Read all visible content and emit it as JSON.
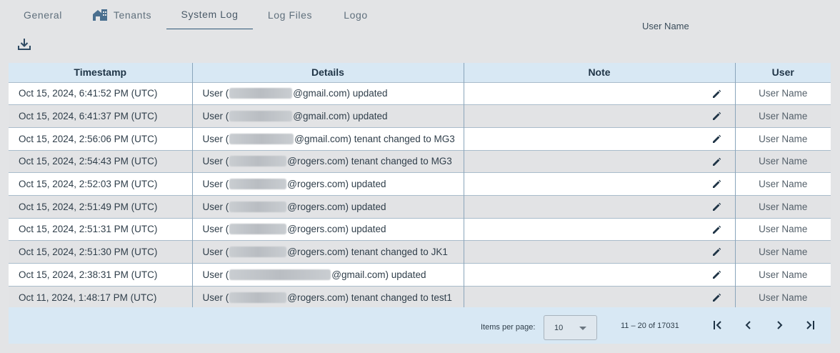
{
  "tabs": [
    {
      "label": "General"
    },
    {
      "label": "Tenants",
      "icon": "home-icon"
    },
    {
      "label": "System Log",
      "active": true
    },
    {
      "label": "Log Files"
    },
    {
      "label": "Logo"
    }
  ],
  "header": {
    "user_name": "User Name"
  },
  "toolbar": {
    "download_icon": "download-icon"
  },
  "table": {
    "columns": [
      "Timestamp",
      "Details",
      "Note",
      "User"
    ],
    "rows": [
      {
        "timestamp": "Oct 15, 2024, 6:41:52 PM (UTC)",
        "detail_prefix": "User (",
        "detail_suffix": "@gmail.com) updated",
        "user": "User Name"
      },
      {
        "timestamp": "Oct 15, 2024, 6:41:37 PM (UTC)",
        "detail_prefix": "User (",
        "detail_suffix": "@gmail.com) updated",
        "user": "User Name"
      },
      {
        "timestamp": "Oct 15, 2024, 2:56:06 PM (UTC)",
        "detail_prefix": "User (",
        "detail_suffix": "@gmail.com) tenant changed to MG3",
        "user": "User Name"
      },
      {
        "timestamp": "Oct 15, 2024, 2:54:43 PM (UTC)",
        "detail_prefix": "User (",
        "detail_suffix": "@rogers.com) tenant changed to MG3",
        "user": "User Name"
      },
      {
        "timestamp": "Oct 15, 2024, 2:52:03 PM (UTC)",
        "detail_prefix": "User (",
        "detail_suffix": "@rogers.com) updated",
        "user": "User Name"
      },
      {
        "timestamp": "Oct 15, 2024, 2:51:49 PM (UTC)",
        "detail_prefix": "User (",
        "detail_suffix": "@rogers.com) updated",
        "user": "User Name"
      },
      {
        "timestamp": "Oct 15, 2024, 2:51:31 PM (UTC)",
        "detail_prefix": "User (",
        "detail_suffix": "@rogers.com) updated",
        "user": "User Name"
      },
      {
        "timestamp": "Oct 15, 2024, 2:51:30 PM (UTC)",
        "detail_prefix": "User (",
        "detail_suffix": "@rogers.com) tenant changed to JK1",
        "user": "User Name"
      },
      {
        "timestamp": "Oct 15, 2024, 2:38:31 PM (UTC)",
        "detail_prefix": "User (",
        "detail_suffix": "@gmail.com) updated",
        "user": "User Name"
      },
      {
        "timestamp": "Oct 11, 2024, 1:48:17 PM (UTC)",
        "detail_prefix": "User (",
        "detail_suffix": "@rogers.com) tenant changed to test1",
        "user": "User Name"
      }
    ]
  },
  "paginator": {
    "items_per_page_label": "Items per page:",
    "items_per_page_value": "10",
    "range_label": "11 – 20 of 17031"
  },
  "colors": {
    "header_bg": "#d8e8f4",
    "accent": "#1f3446",
    "page_bg": "#e3e4e6"
  }
}
